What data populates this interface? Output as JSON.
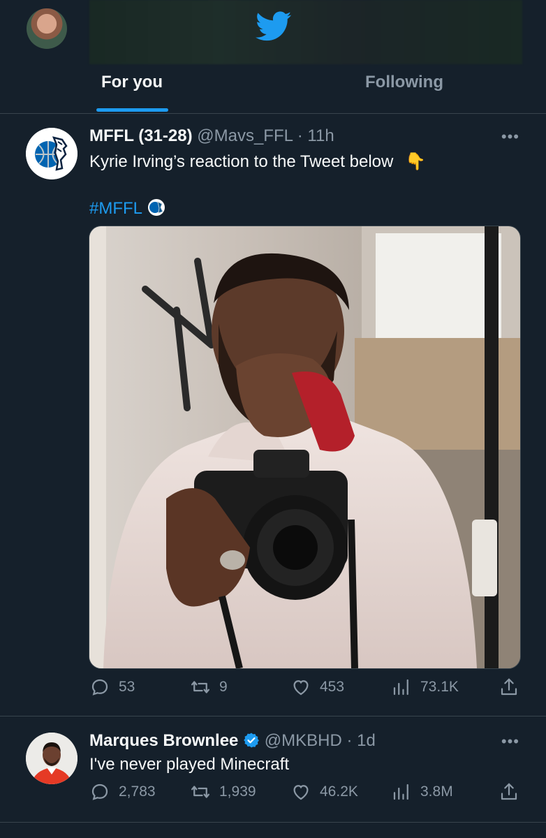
{
  "header": {
    "tabs": [
      {
        "label": "For you",
        "active": true
      },
      {
        "label": "Following",
        "active": false
      }
    ]
  },
  "colors": {
    "accent": "#1d9bf0",
    "background": "#15202b",
    "muted": "#8b98a5",
    "divider": "#38444d"
  },
  "tweets": [
    {
      "name": "MFFL (31-28)",
      "handle": "@Mavs_FFL",
      "time": "· 11h",
      "text": "Kyrie Irving’s reaction to the Tweet below",
      "emoji": "👇",
      "hashtag": "#MFFL",
      "more": "•••",
      "media_icon": "photo-kyrie-camera",
      "stats": {
        "replies": "53",
        "retweets": "9",
        "likes": "453",
        "views": "73.1K"
      }
    },
    {
      "name": "Marques Brownlee",
      "verified": true,
      "handle": "@MKBHD",
      "time": "· 1d",
      "text": "I've never played Minecraft",
      "more": "•••",
      "stats": {
        "replies": "2,783",
        "retweets": "1,939",
        "likes": "46.2K",
        "views": "3.8M"
      }
    }
  ]
}
